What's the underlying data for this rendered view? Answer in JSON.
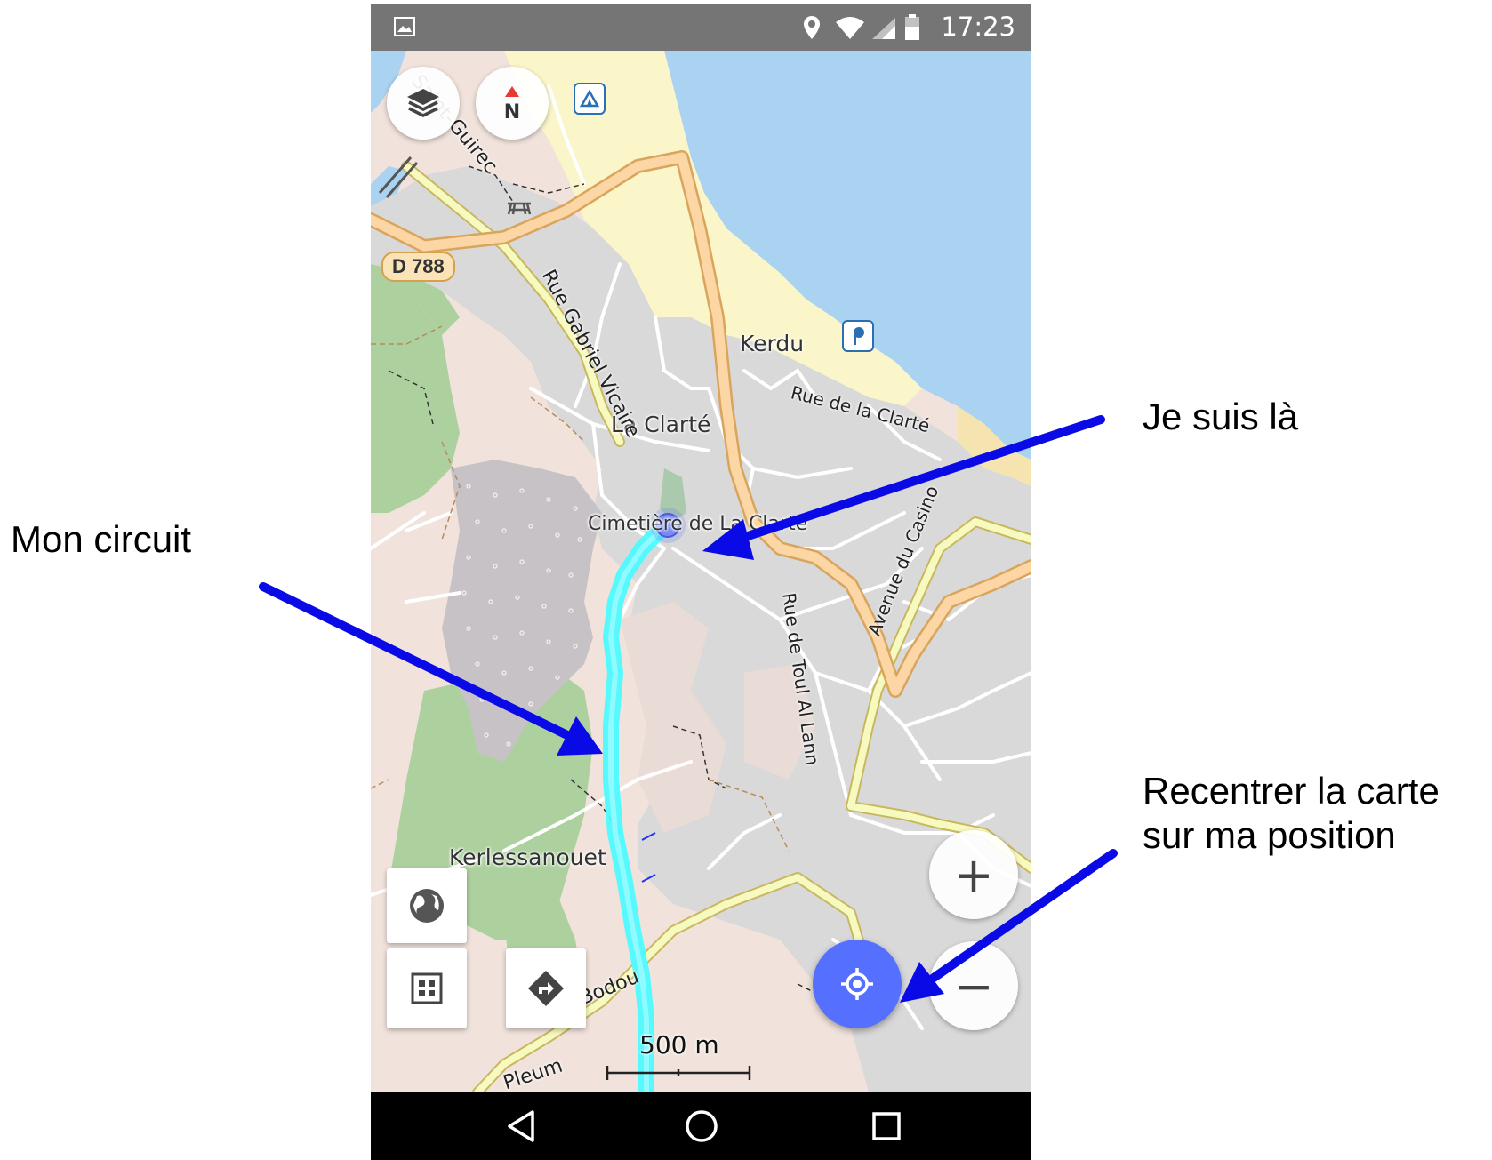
{
  "annotations": {
    "current_position": "Je suis là",
    "my_route": "Mon circuit",
    "recenter_line1": "Recentrer la carte",
    "recenter_line2": "sur ma position"
  },
  "status_bar": {
    "time": "17:23"
  },
  "map": {
    "places": [
      "Kerdu",
      "La Clarté",
      "Cimetière de La Clarté",
      "Kerlessanouet"
    ],
    "roads": [
      "Rue Gabriel Vicaire",
      "Rue de la Clarté",
      "Avenue du Casino",
      "Rue de Toul Al Lann",
      "Saint-Guirec",
      "Bodou",
      "Pleum"
    ],
    "road_shield": "D 788",
    "scale": "500 m"
  },
  "buttons": {
    "zoom_in": "+",
    "zoom_out": "−"
  },
  "colors": {
    "route": "#4dfaff",
    "location": "#6a7ff0",
    "locate_button": "#5570ff",
    "arrow": "#0a0ae6"
  },
  "icons": [
    "layers-icon",
    "compass-icon",
    "camping-icon",
    "parking-icon",
    "picnic-icon",
    "globe-icon",
    "grid-icon",
    "directions-icon",
    "my-location-icon",
    "back-icon",
    "home-icon",
    "recents-icon",
    "image-icon",
    "location-status-icon",
    "wifi-icon",
    "signal-icon",
    "battery-icon"
  ]
}
